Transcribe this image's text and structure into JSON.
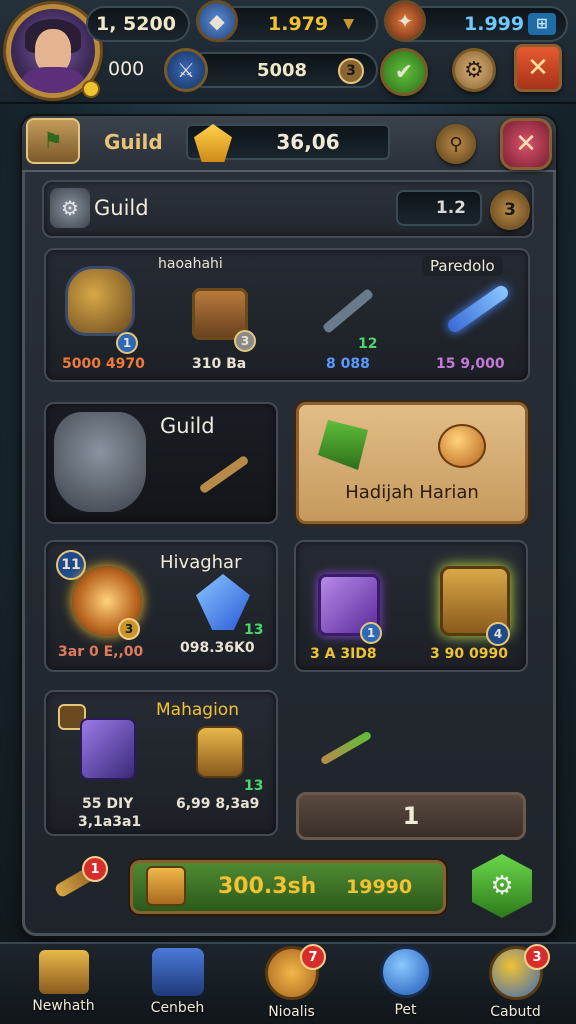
{
  "top_bar": {
    "resource_1": "1, 5200",
    "resource_2": "1.979",
    "resource_3": "1.999",
    "level_text": "000",
    "xp_text": "5008",
    "xp_badge": "3"
  },
  "panel": {
    "header_title": "Guild",
    "header_value": "36,06",
    "close_symbol": "✕"
  },
  "guild_section": {
    "title": "Guild",
    "counter": "1.2",
    "counter_btn": "3"
  },
  "featured_row": {
    "label_left": "haoahahi",
    "label_right": "Paredolo",
    "items": [
      {
        "price": "5000 4970",
        "badge": "1"
      },
      {
        "price": "310 Ba",
        "badge": "3"
      },
      {
        "price": "8 088",
        "badge": "12"
      },
      {
        "price": "15 9,000",
        "badge": ""
      }
    ]
  },
  "guild_card": {
    "title": "Guild"
  },
  "daily_card": {
    "label": "Hadijah Harian"
  },
  "rare_card": {
    "title": "Hivaghar",
    "corner_badge": "11",
    "item_badge": "3",
    "price_left": "3ar 0 E,,00",
    "price_right": "098.36K0",
    "gem_badge": "13"
  },
  "chest_card": {
    "price_left": "3 A 3ID8",
    "price_right": "3 90 0990",
    "badge_left": "1",
    "badge_right": "4"
  },
  "mahagion_card": {
    "title": "Mahagion",
    "price_left_1": "55 DIY",
    "price_left_2": "3,1a3a1",
    "price_right": "6,99 8,3a9",
    "badge": "13"
  },
  "quantity_field": {
    "value": "1"
  },
  "purchase_bar": {
    "main_label": "300.3sh",
    "amount": "19990",
    "bell_badge": "1"
  },
  "bottom_nav": [
    {
      "label": "Newhath",
      "badge": ""
    },
    {
      "label": "Cenbeh",
      "badge": ""
    },
    {
      "label": "Nioalis",
      "badge": "7"
    },
    {
      "label": "Pet",
      "badge": ""
    },
    {
      "label": "Cabutd",
      "badge": "3"
    }
  ],
  "colors": {
    "gold": "#f1c232",
    "purchase_green": "#3e7a2e",
    "close_red": "#c8412a",
    "daily_tan": "#d8b07a"
  },
  "icons": {
    "resource_1": "coin-icon",
    "resource_2": "gem-icon",
    "resource_3": "energy-icon"
  }
}
